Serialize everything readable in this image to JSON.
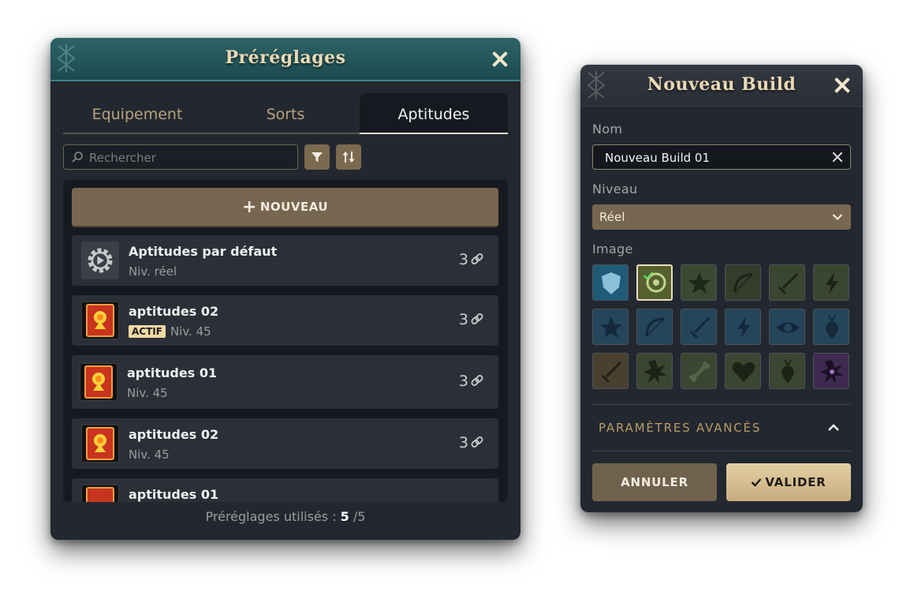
{
  "presets": {
    "title": "Préréglages",
    "tabs": [
      "Equipement",
      "Sorts",
      "Aptitudes"
    ],
    "active_tab": "Aptitudes",
    "search": {
      "placeholder": "Rechercher",
      "value": ""
    },
    "new_label": "NOUVEAU",
    "items": [
      {
        "name": "Aptitudes par défaut",
        "level": "Niv. réel",
        "badge": "",
        "count": "3",
        "icon": "gear-play-icon"
      },
      {
        "name": "aptitudes 02",
        "level": "Niv. 45",
        "badge": "ACTIF",
        "count": "3",
        "icon": "skill-book-icon"
      },
      {
        "name": "aptitudes 01",
        "level": "Niv. 45",
        "badge": "",
        "count": "3",
        "icon": "skill-book-icon"
      },
      {
        "name": "aptitudes 02",
        "level": "Niv. 45",
        "badge": "",
        "count": "3",
        "icon": "skill-book-icon"
      },
      {
        "name": "aptitudes 01",
        "level": "",
        "badge": "",
        "count": "",
        "icon": "skill-book-icon"
      }
    ],
    "footer": {
      "label": "Préréglages utilisés :",
      "used": "5",
      "total": "/5"
    }
  },
  "build": {
    "title": "Nouveau Build",
    "name_label": "Nom",
    "name_value": "Nouveau Build 01",
    "level_label": "Niveau",
    "level_value": "Réel",
    "image_label": "Image",
    "selected_image": 1,
    "images": [
      "shield-icon",
      "target-icon",
      "star-icon",
      "bow-icon",
      "sword-icon",
      "lightning-icon",
      "star-icon",
      "bow-icon",
      "sword-icon",
      "lightning-icon",
      "eye-icon",
      "carrot-icon",
      "sword-icon",
      "explosion-icon",
      "bone-icon",
      "heart-icon",
      "carrot-icon",
      "explosion-icon"
    ],
    "advanced_label": "PARAMÈTRES AVANCÉS",
    "cancel_label": "ANNULER",
    "ok_label": "VALIDER"
  },
  "colors": {
    "accent_gold": "#776650",
    "teal_header": "#24585c",
    "panel": "#232830"
  }
}
